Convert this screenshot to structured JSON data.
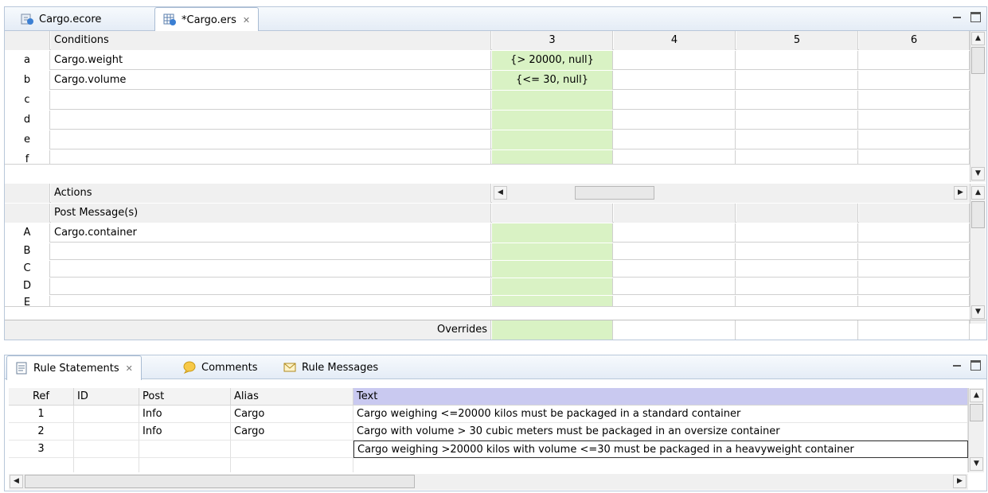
{
  "editor": {
    "tabs": [
      {
        "label": "Cargo.ecore",
        "icon": "ecore-model-icon"
      },
      {
        "label": "*Cargo.ers",
        "icon": "ruleset-icon",
        "close": "✕"
      }
    ],
    "conditions": {
      "header": "Conditions",
      "rows": [
        {
          "id": "a",
          "text": "Cargo.weight",
          "col3": "{> 20000, null}"
        },
        {
          "id": "b",
          "text": "Cargo.volume",
          "col3": "{<= 30, null}"
        },
        {
          "id": "c",
          "text": "",
          "col3": ""
        },
        {
          "id": "d",
          "text": "",
          "col3": ""
        },
        {
          "id": "e",
          "text": "",
          "col3": ""
        },
        {
          "id": "f",
          "text": "",
          "col3": ""
        }
      ],
      "columns": [
        "3",
        "4",
        "5",
        "6"
      ]
    },
    "actions": {
      "header": "Actions",
      "post_header": "Post Message(s)",
      "rows": [
        {
          "id": "A",
          "text": "Cargo.container"
        },
        {
          "id": "B",
          "text": ""
        },
        {
          "id": "C",
          "text": ""
        },
        {
          "id": "D",
          "text": ""
        },
        {
          "id": "E",
          "text": ""
        }
      ]
    },
    "overrides_label": "Overrides"
  },
  "view": {
    "tabs": [
      {
        "label": "Rule Statements",
        "icon": "document-icon",
        "close": "✕"
      },
      {
        "label": "Comments",
        "icon": "comment-bubble-icon"
      },
      {
        "label": "Rule Messages",
        "icon": "envelope-icon"
      }
    ],
    "table": {
      "headers": [
        "Ref",
        "ID",
        "Post",
        "Alias",
        "Text"
      ],
      "rows": [
        {
          "ref": "1",
          "id": "",
          "post": "Info",
          "alias": "Cargo",
          "text": "Cargo weighing <=20000 kilos must be packaged in a standard container"
        },
        {
          "ref": "2",
          "id": "",
          "post": "Info",
          "alias": "Cargo",
          "text": "Cargo with volume > 30 cubic meters must be packaged in an oversize container"
        },
        {
          "ref": "3",
          "id": "",
          "post": "",
          "alias": "",
          "text": "Cargo weighing >20000 kilos with volume <=30 must be packaged in a heavyweight container"
        }
      ]
    }
  },
  "colors": {
    "rule_column": "#d9f2c4",
    "text_header": "#c9c9f0",
    "tab_border": "#b8c7da"
  }
}
